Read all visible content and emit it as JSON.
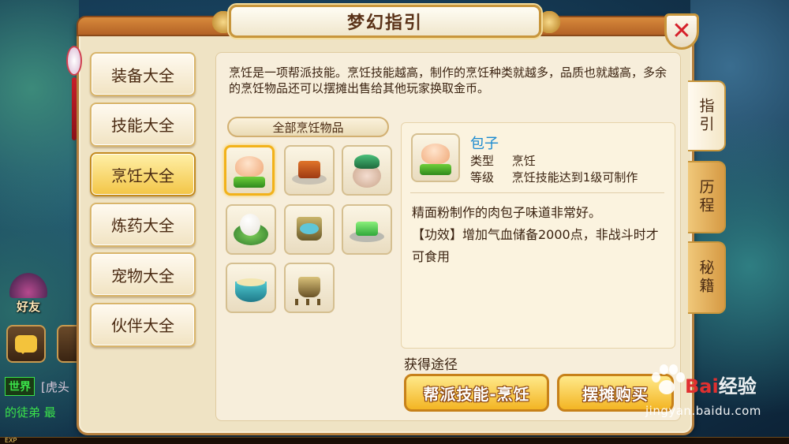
{
  "window": {
    "title": "梦幻指引",
    "close_symbol": "✕"
  },
  "menu": [
    {
      "label": "装备大全",
      "active": false
    },
    {
      "label": "技能大全",
      "active": false
    },
    {
      "label": "烹饪大全",
      "active": true
    },
    {
      "label": "炼药大全",
      "active": false
    },
    {
      "label": "宠物大全",
      "active": false
    },
    {
      "label": "伙伴大全",
      "active": false
    }
  ],
  "intro": "烹饪是一项帮派技能。烹饪技能越高，制作的烹饪种类就越多，品质也就越高，多余的烹饪物品还可以摆摊出售给其他玩家换取金币。",
  "section_title": "全部烹饪物品",
  "items": [
    {
      "icon": "steamed-bun-icon",
      "selected": true
    },
    {
      "icon": "braised-tofu-icon",
      "selected": false
    },
    {
      "icon": "wine-jar-icon",
      "selected": false
    },
    {
      "icon": "rice-dumpling-icon",
      "selected": false
    },
    {
      "icon": "bronze-pot-icon",
      "selected": false
    },
    {
      "icon": "green-cake-icon",
      "selected": false
    },
    {
      "icon": "noodle-bowl-icon",
      "selected": false
    },
    {
      "icon": "tripod-cauldron-icon",
      "selected": false
    }
  ],
  "detail": {
    "name": "包子",
    "type_key": "类型",
    "type_value": "烹饪",
    "level_key": "等级",
    "level_value": "烹饪技能达到1级可制作",
    "description_1": "精面粉制作的肉包子味道非常好。",
    "description_2": "【功效】增加气血储备2000点，非战斗时才可食用"
  },
  "acquire": {
    "label": "获得途径",
    "buttons": [
      "帮派技能-烹饪",
      "摆摊购买"
    ]
  },
  "side_tabs": [
    "指引",
    "历程",
    "秘籍"
  ],
  "hud": {
    "friend_label": "好友",
    "world_channel": "世界",
    "world_text": "[虎头",
    "chat_line": "的徒弟   最",
    "exp_label": "EXP"
  },
  "watermark": {
    "brand_prefix": "Bai",
    "brand_suffix": "经验",
    "url": "jingyan.baidu.com"
  },
  "colors": {
    "panel_bg": "#efe3c4",
    "border_gold": "#c8963c",
    "active_menu": "#f3c546",
    "item_name": "#1a8ad0",
    "close_red": "#d6202a",
    "world_green": "#3be34a"
  }
}
